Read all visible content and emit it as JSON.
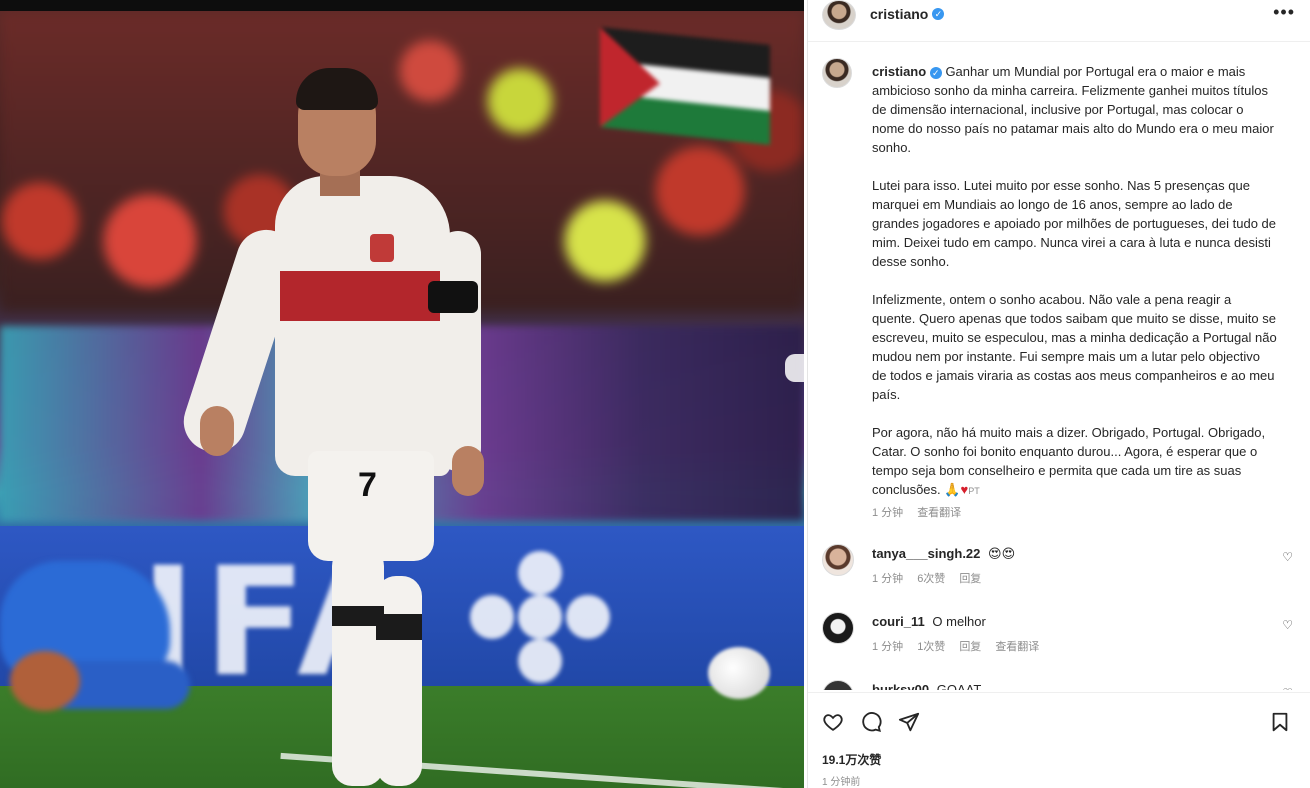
{
  "header": {
    "username": "cristiano",
    "more_label": "•••"
  },
  "caption": {
    "username": "cristiano",
    "paragraphs": [
      "Ganhar um Mundial por Portugal era o maior e mais ambicioso sonho da minha carreira. Felizmente ganhei muitos títulos de dimensão internacional, inclusive por Portugal, mas colocar o nome do nosso país no patamar mais alto do Mundo era o meu maior sonho.",
      "Lutei para isso. Lutei muito por esse sonho. Nas 5 presenças que marquei em Mundiais ao longo de 16 anos, sempre ao lado de grandes jogadores e apoiado por milhões de portugueses, dei tudo de mim. Deixei tudo em campo. Nunca virei a cara à luta e nunca desisti desse sonho.",
      "Infelizmente, ontem o sonho acabou. Não vale a pena reagir a quente. Quero apenas que todos saibam que muito se disse, muito se escreveu, muito se especulou, mas a minha dedicação a Portugal não mudou nem por instante. Fui sempre mais um a lutar pelo objectivo de todos e jamais viraria as costas aos meus companheiros e ao meu país.",
      "Por agora, não há muito mais a dizer. Obrigado, Portugal. Obrigado, Catar. O sonho foi bonito enquanto durou... Agora, é esperar que o tempo seja bom conselheiro e permita que cada um tire as suas conclusões."
    ],
    "emoji_flag": "PT",
    "time": "1 分钟",
    "see_translation": "查看翻译"
  },
  "comments": [
    {
      "username": "tanya___singh.22",
      "text": "",
      "time": "1 分钟",
      "likes": "6次赞",
      "reply": "回复",
      "translation": ""
    },
    {
      "username": "couri_11",
      "text": "O melhor",
      "time": "1 分钟",
      "likes": "1次赞",
      "reply": "回复",
      "translation": "查看翻译"
    },
    {
      "username": "burksy00",
      "text": "GOAAT",
      "time": "",
      "likes": "",
      "reply": "",
      "translation": ""
    }
  ],
  "actions": {
    "likes_count": "19.1万次赞",
    "post_time": "1 分钟前"
  },
  "photo": {
    "jersey_number": "7"
  }
}
